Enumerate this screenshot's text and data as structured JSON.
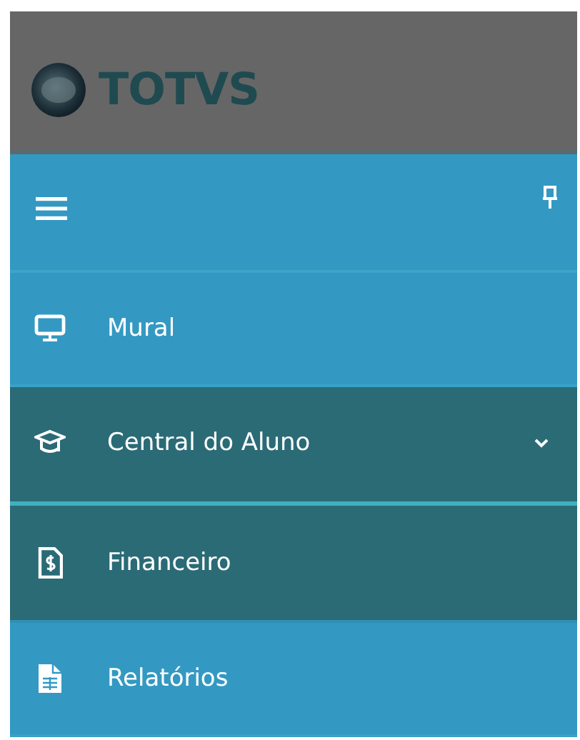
{
  "header": {
    "logo_text": "TOTVS"
  },
  "toolbar": {
    "pinned": true
  },
  "menu": [
    {
      "label": "Mural"
    },
    {
      "label": "Central do Aluno",
      "expanded": true,
      "children": [
        {
          "label": "Financeiro"
        }
      ]
    },
    {
      "label": "Relatórios"
    }
  ]
}
